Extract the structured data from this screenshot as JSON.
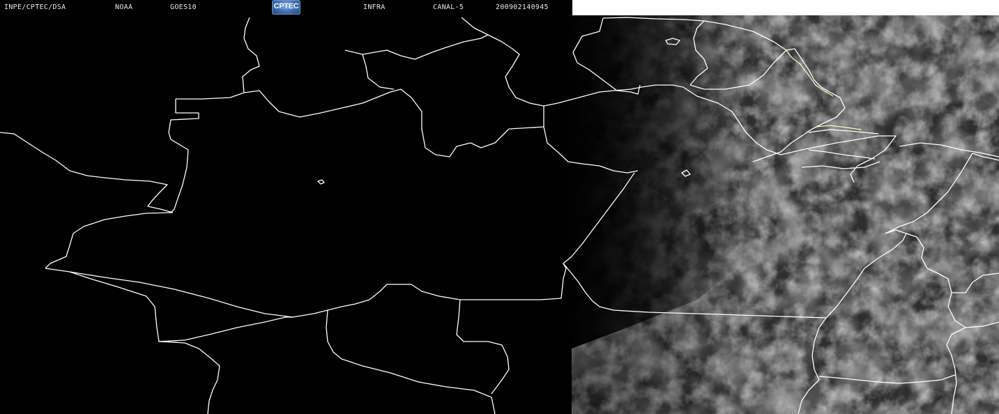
{
  "header": {
    "source": "INPE/CPTEC/DSA",
    "agency": "NOAA",
    "satellite": "GOES10",
    "logo_text": "CPTEC",
    "product": "INFRA",
    "channel": "CANAL-5",
    "timestamp": "200902140945"
  },
  "colors": {
    "background": "#000000",
    "border_lines": "#ffffff",
    "border_lines_east": "#ffffcc",
    "cloud_light": "#9a9a9a",
    "cloud_dark": "#3a3a3a",
    "header_bg_right": "#ffffff"
  }
}
